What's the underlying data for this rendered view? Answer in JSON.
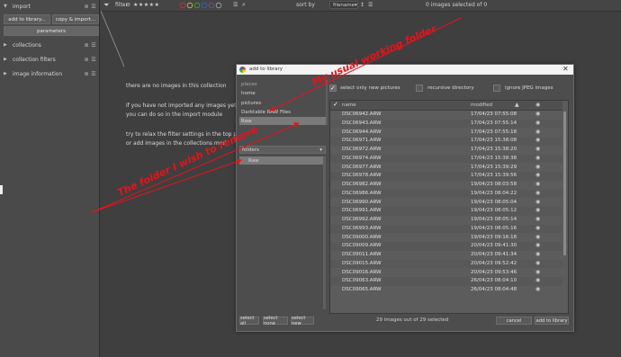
{
  "sidebar": {
    "sections": [
      {
        "label": "import",
        "expanded": true
      },
      {
        "label": "collections",
        "expanded": false
      },
      {
        "label": "collection filters",
        "expanded": false
      },
      {
        "label": "image information",
        "expanded": false
      }
    ],
    "add_to_library": "add to library...",
    "copy_import": "copy & import...",
    "parameters": "parameters"
  },
  "topbar": {
    "filter_label": "filter",
    "stars": "★★★★★",
    "sort_label": "sort by",
    "sort_value": "filename",
    "selected_info": "0 images selected of 0"
  },
  "center": {
    "line1": "there are no images in this collection",
    "line2": "if you have not imported any images yet",
    "line3": "you can do so in the import module",
    "line4": "try to relax the filter settings in the top pan",
    "line5": "or add images in the collections mod"
  },
  "dialog": {
    "title": "add to library",
    "places_header": "places",
    "places": [
      "home",
      "pictures",
      "Darktable RAW Files",
      "Raw"
    ],
    "folders_header": "folders",
    "folders": [
      "Raw"
    ],
    "opt_new": "select only new pictures",
    "opt_recursive": "recursive directory",
    "opt_jpeg": "ignore JPEG images",
    "col_name": "name",
    "col_modified": "modified",
    "files": [
      {
        "name": "DSC06942.ARW",
        "date": "17/04/23 07:55:08"
      },
      {
        "name": "DSC06943.ARW",
        "date": "17/04/23 07:55:14"
      },
      {
        "name": "DSC06944.ARW",
        "date": "17/04/23 07:55:18"
      },
      {
        "name": "DSC06971.ARW",
        "date": "17/04/23 15:38:08"
      },
      {
        "name": "DSC06972.ARW",
        "date": "17/04/23 15:38:20"
      },
      {
        "name": "DSC06974.ARW",
        "date": "17/04/23 15:38:38"
      },
      {
        "name": "DSC06977.ARW",
        "date": "17/04/23 15:39:29"
      },
      {
        "name": "DSC06978.ARW",
        "date": "17/04/23 15:39:56"
      },
      {
        "name": "DSC06982.ARW",
        "date": "19/04/23 08:03:58"
      },
      {
        "name": "DSC06986.ARW",
        "date": "19/04/23 08:04:22"
      },
      {
        "name": "DSC06990.ARW",
        "date": "19/04/23 08:05:04"
      },
      {
        "name": "DSC06991.ARW",
        "date": "19/04/23 08:05:12"
      },
      {
        "name": "DSC06992.ARW",
        "date": "19/04/23 08:05:14"
      },
      {
        "name": "DSC06993.ARW",
        "date": "19/04/23 08:05:16"
      },
      {
        "name": "DSC09000.ARW",
        "date": "19/04/23 09:16:18"
      },
      {
        "name": "DSC09009.ARW",
        "date": "20/04/23 09:41:30"
      },
      {
        "name": "DSC09011.ARW",
        "date": "20/04/23 09:41:34"
      },
      {
        "name": "DSC09015.ARW",
        "date": "20/04/23 09:52:42"
      },
      {
        "name": "DSC09016.ARW",
        "date": "20/04/23 09:53:46"
      },
      {
        "name": "DSC09063.ARW",
        "date": "26/04/23 08:04:10"
      },
      {
        "name": "DSC09065.ARW",
        "date": "26/04/23 08:04:48"
      }
    ],
    "select_all": "select all",
    "select_none": "select none",
    "select_new": "select new",
    "count_info": "29 images out of 29 selected",
    "cancel": "cancel",
    "add_btn": "add to library"
  },
  "annotations": {
    "working_folder": "My usual working folder",
    "remove_folder": "The folder I wish to remove"
  },
  "colors": {
    "annotation": "#e8121a",
    "dialog_bg": "#4d4d4d",
    "selected_row": "#7a7a7a"
  }
}
